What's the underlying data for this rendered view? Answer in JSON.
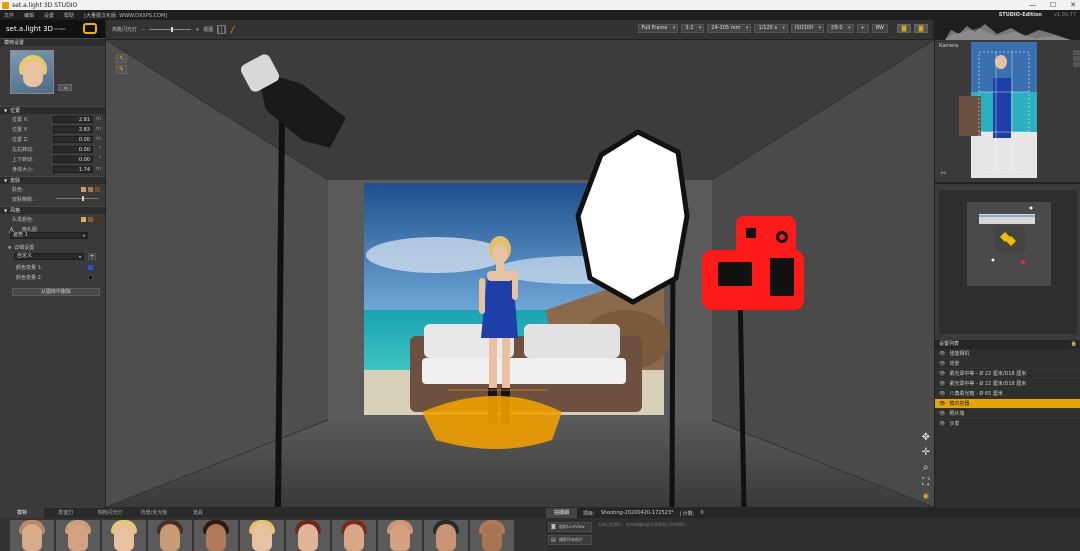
{
  "window": {
    "title": "set.a.light 3D STUDIO",
    "controls": [
      "—",
      "☐",
      "✕"
    ]
  },
  "menu": {
    "items": [
      "文件",
      "编辑",
      "设置",
      "帮助",
      "[大量摄汉化版: WWW.DXXPS.COM]"
    ],
    "edition": "STUDIO-Edition",
    "version": "v1.00.77"
  },
  "logo": {
    "text": "set.a.light 3D",
    "superscript": "STUDIO"
  },
  "left": {
    "model_section": "模特设置",
    "avatar_button": "◄",
    "position_section": "位置",
    "position_props": [
      {
        "label": "位置 X:",
        "value": "2.81",
        "unit": "m"
      },
      {
        "label": "位置 Y:",
        "value": "2.83",
        "unit": "m"
      },
      {
        "label": "位置 Z:",
        "value": "0.00",
        "unit": "m"
      },
      {
        "label": "左右转动:",
        "value": "0.00",
        "unit": "°"
      },
      {
        "label": "上下转动:",
        "value": "0.00",
        "unit": "°"
      },
      {
        "label": "身体大小:",
        "value": "1.74",
        "unit": "m"
      }
    ],
    "skin_section": "皮肤",
    "skin_color_label": "肤色:",
    "skin_slider_label": "皮肤精致:",
    "style_section": "风格",
    "hair_color_label": "头发颜色:",
    "outfit_label": "晚礼服",
    "outfit_value": "姿势 1",
    "detail_section": "详细设置",
    "custom_select": "自定义",
    "color1_label": "颜色变量 1:",
    "color2_label": "颜色变量 2:",
    "load_button": "从图库中删除"
  },
  "toolbar": {
    "mode_label": "热靴闪光灯",
    "grid_label": "视图",
    "frame": "Full Frame",
    "ratio": "3:2",
    "lens": "24-105 mm",
    "shutter": "1/125 s",
    "iso": "ISO100",
    "aperture": "f/9.0",
    "plus": "+",
    "bw": "BW"
  },
  "colors": {
    "accent": "#f0b400",
    "selected_row": "#e8a400",
    "camera_red": "#ff1a1a",
    "swatch1": "#c89a78",
    "swatch2": "#a8784e",
    "swatch3": "#7a4a2a",
    "hair1": "#d8b060",
    "hair2": "#8a5a2a",
    "hair3": "#5a2a1a",
    "blue_var": "#2255cc",
    "dark_var": "#111111"
  },
  "right": {
    "camera_label": "Kamera",
    "scene_list_title": "设置列表",
    "scene_items": [
      {
        "label": "佳能相机",
        "selected": false
      },
      {
        "label": "背景",
        "selected": false
      },
      {
        "label": "柔光罩中等 - Ø 22 厘米/D18 厘米",
        "selected": false
      },
      {
        "label": "柔光罩中等 - Ø 22 厘米/D18 厘米",
        "selected": false
      },
      {
        "label": "八角柔光箱 - Ø 65 厘米",
        "selected": false
      },
      {
        "label": "模内容器",
        "selected": true
      },
      {
        "label": "照片墙",
        "selected": false
      },
      {
        "label": "沙发",
        "selected": false
      }
    ]
  },
  "bottom": {
    "tabs": [
      "模特",
      "影室灯",
      "热靴闪光灯",
      "背景/反光板",
      "道具"
    ],
    "models": [
      {
        "skin": "#d8ab8a",
        "hair": "#b88a6a"
      },
      {
        "skin": "#d2a282",
        "hair": "#c9a07a"
      },
      {
        "skin": "#e8c2a0",
        "hair": "#e6c870"
      },
      {
        "skin": "#c79a78",
        "hair": "#4a3020"
      },
      {
        "skin": "#b07a58",
        "hair": "#2a1a12"
      },
      {
        "skin": "#e6c2a0",
        "hair": "#e2c46a"
      },
      {
        "skin": "#e0b496",
        "hair": "#6a2a1a"
      },
      {
        "skin": "#d8a886",
        "hair": "#7a2a1a"
      },
      {
        "skin": "#d4a080",
        "hair": "#c89474"
      },
      {
        "skin": "#c89474",
        "hair": "#2a2a2a"
      },
      {
        "skin": "#a87452",
        "hair": "#b07a58"
      }
    ],
    "session_tab": "拍摄期",
    "session_label": "项目:",
    "session_name": "Shooting-20200420-172523*",
    "counter_label": "| 计数:",
    "counter_value": "0",
    "session_desc": "没有已拍照片。在你拍摄时此列表将显示你的照片。",
    "session_btn1": "摄影LiveView",
    "session_btn2": "摄影所有照片"
  }
}
